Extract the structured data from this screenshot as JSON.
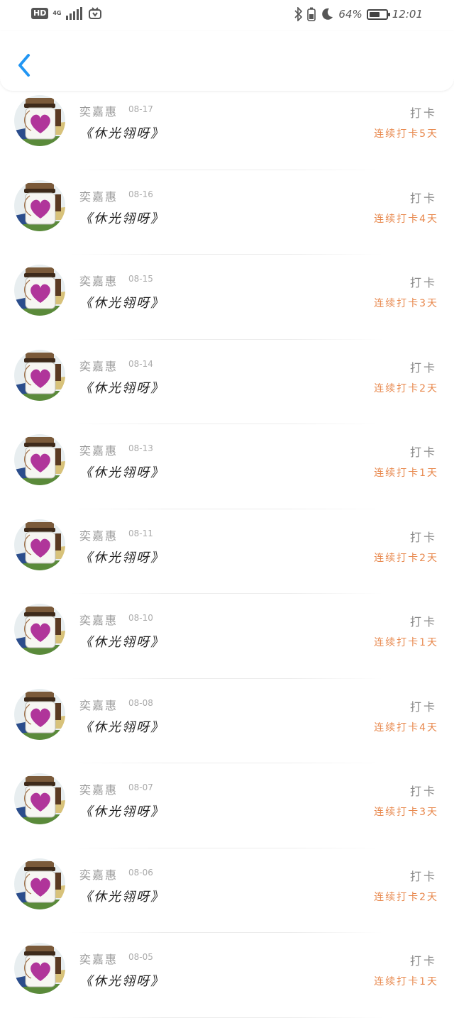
{
  "status_bar": {
    "hd": "HD",
    "network": "4G",
    "battery_text": "64%",
    "battery_level": 0.64,
    "time": "12:01"
  },
  "header": {
    "back_icon": "chevron-left-icon"
  },
  "colors": {
    "accent_blue": "#2196f3",
    "streak_orange": "#e8884d"
  },
  "entries": [
    {
      "name": "奕嘉惠",
      "date": "08-17",
      "title": "《休光翎呀》",
      "checkin": "打卡",
      "streak": "连续打卡5天"
    },
    {
      "name": "奕嘉惠",
      "date": "08-16",
      "title": "《休光翎呀》",
      "checkin": "打卡",
      "streak": "连续打卡4天"
    },
    {
      "name": "奕嘉惠",
      "date": "08-15",
      "title": "《休光翎呀》",
      "checkin": "打卡",
      "streak": "连续打卡3天"
    },
    {
      "name": "奕嘉惠",
      "date": "08-14",
      "title": "《休光翎呀》",
      "checkin": "打卡",
      "streak": "连续打卡2天"
    },
    {
      "name": "奕嘉惠",
      "date": "08-13",
      "title": "《休光翎呀》",
      "checkin": "打卡",
      "streak": "连续打卡1天"
    },
    {
      "name": "奕嘉惠",
      "date": "08-11",
      "title": "《休光翎呀》",
      "checkin": "打卡",
      "streak": "连续打卡2天"
    },
    {
      "name": "奕嘉惠",
      "date": "08-10",
      "title": "《休光翎呀》",
      "checkin": "打卡",
      "streak": "连续打卡1天"
    },
    {
      "name": "奕嘉惠",
      "date": "08-08",
      "title": "《休光翎呀》",
      "checkin": "打卡",
      "streak": "连续打卡4天"
    },
    {
      "name": "奕嘉惠",
      "date": "08-07",
      "title": "《休光翎呀》",
      "checkin": "打卡",
      "streak": "连续打卡3天"
    },
    {
      "name": "奕嘉惠",
      "date": "08-06",
      "title": "《休光翎呀》",
      "checkin": "打卡",
      "streak": "连续打卡2天"
    },
    {
      "name": "奕嘉惠",
      "date": "08-05",
      "title": "《休光翎呀》",
      "checkin": "打卡",
      "streak": "连续打卡1天"
    }
  ]
}
